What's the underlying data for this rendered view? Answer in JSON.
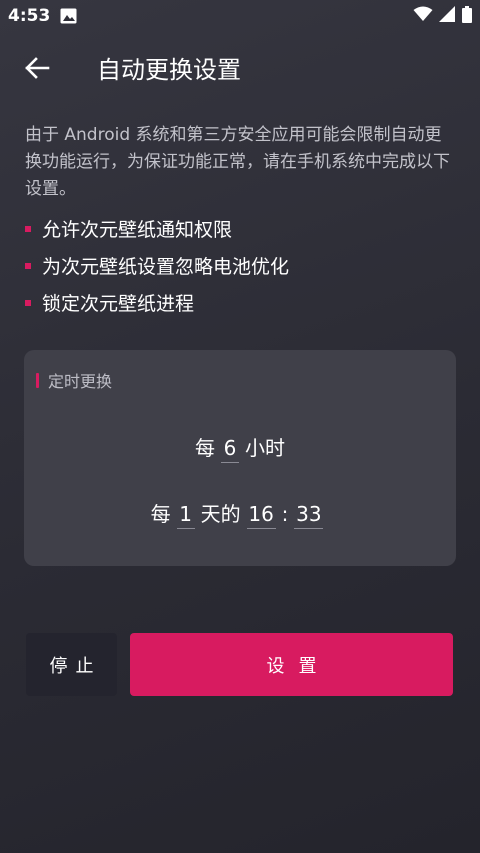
{
  "status_bar": {
    "time": "4:53",
    "icons": [
      "photo-notification-icon",
      "wifi-icon",
      "cellular-signal-icon",
      "battery-icon"
    ]
  },
  "app_bar": {
    "back_icon": "arrow-left-icon",
    "title": "自动更换设置"
  },
  "description": "由于 Android 系统和第三方安全应用可能会限制自动更换功能运行，为保证功能正常，请在手机系统中完成以下设置。",
  "bullets": [
    "允许次元壁纸通知权限",
    "为次元壁纸设置忽略电池优化",
    "锁定次元壁纸进程"
  ],
  "timer_card": {
    "title": "定时更换",
    "interval": {
      "prefix": "每",
      "hours": "6",
      "unit": "小时"
    },
    "daily": {
      "prefix": "每",
      "days": "1",
      "unit": "天的",
      "hour": "16",
      "separator": ":",
      "minute": "33"
    }
  },
  "actions": {
    "stop_label": "停止",
    "set_label": "设置"
  },
  "colors": {
    "accent": "#d81b60",
    "background": "#2f2f38",
    "card": "#404049",
    "stop_button": "#24242e"
  }
}
